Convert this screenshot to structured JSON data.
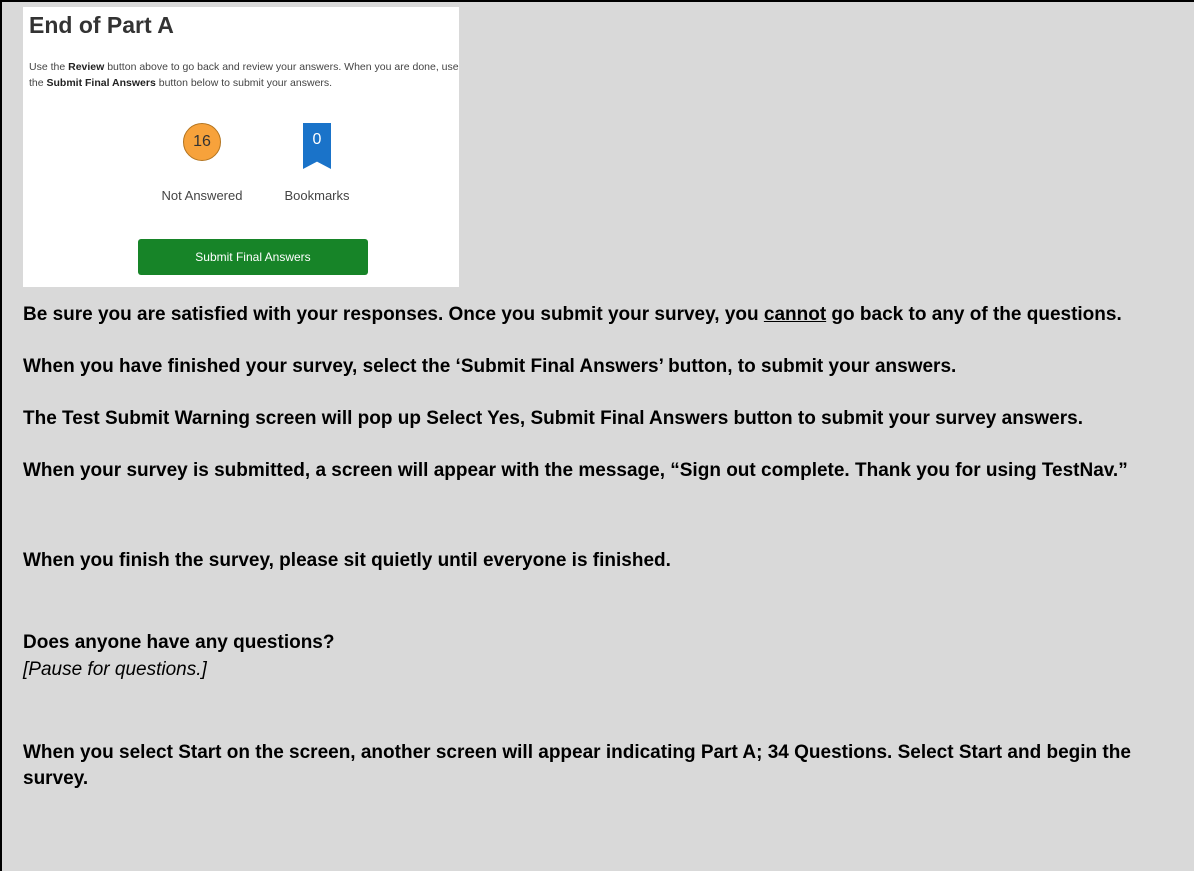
{
  "card": {
    "title": "End of Part A",
    "desc_1": "Use the ",
    "desc_review": "Review",
    "desc_2": " button above to go back and review your answers. When you are done, use the ",
    "desc_submit": "Submit Final Answers",
    "desc_3": " button below to submit your answers.",
    "not_answered_count": "16",
    "not_answered_label": "Not Answered",
    "bookmarks_count": "0",
    "bookmarks_label": "Bookmarks",
    "submit_label": "Submit Final Answers",
    "colors": {
      "not_answered": "#f7a23b",
      "bookmark": "#1a73c9",
      "submit": "#178428"
    }
  },
  "instructions": {
    "p1_a": "Be sure you are satisfied with your responses. Once you submit your survey, you ",
    "p1_cannot": "cannot",
    "p1_b": " go back to any of the questions.",
    "p2": "When you have finished your survey, select the ‘Submit Final Answers’ button, to submit your answers.",
    "p3": "The Test Submit Warning screen will pop up Select Yes, Submit Final Answers button to submit your survey answers.",
    "p4": "When your survey is submitted, a screen will appear with the message, “Sign out complete. Thank you for using TestNav.”",
    "p5": "When you finish the survey, please sit quietly until everyone is finished.",
    "p6": "Does anyone have any questions?",
    "p7": "[Pause for questions.]",
    "p8": "When you select Start on the screen, another screen will appear indicating Part A; 34 Questions. Select Start and begin the survey."
  }
}
